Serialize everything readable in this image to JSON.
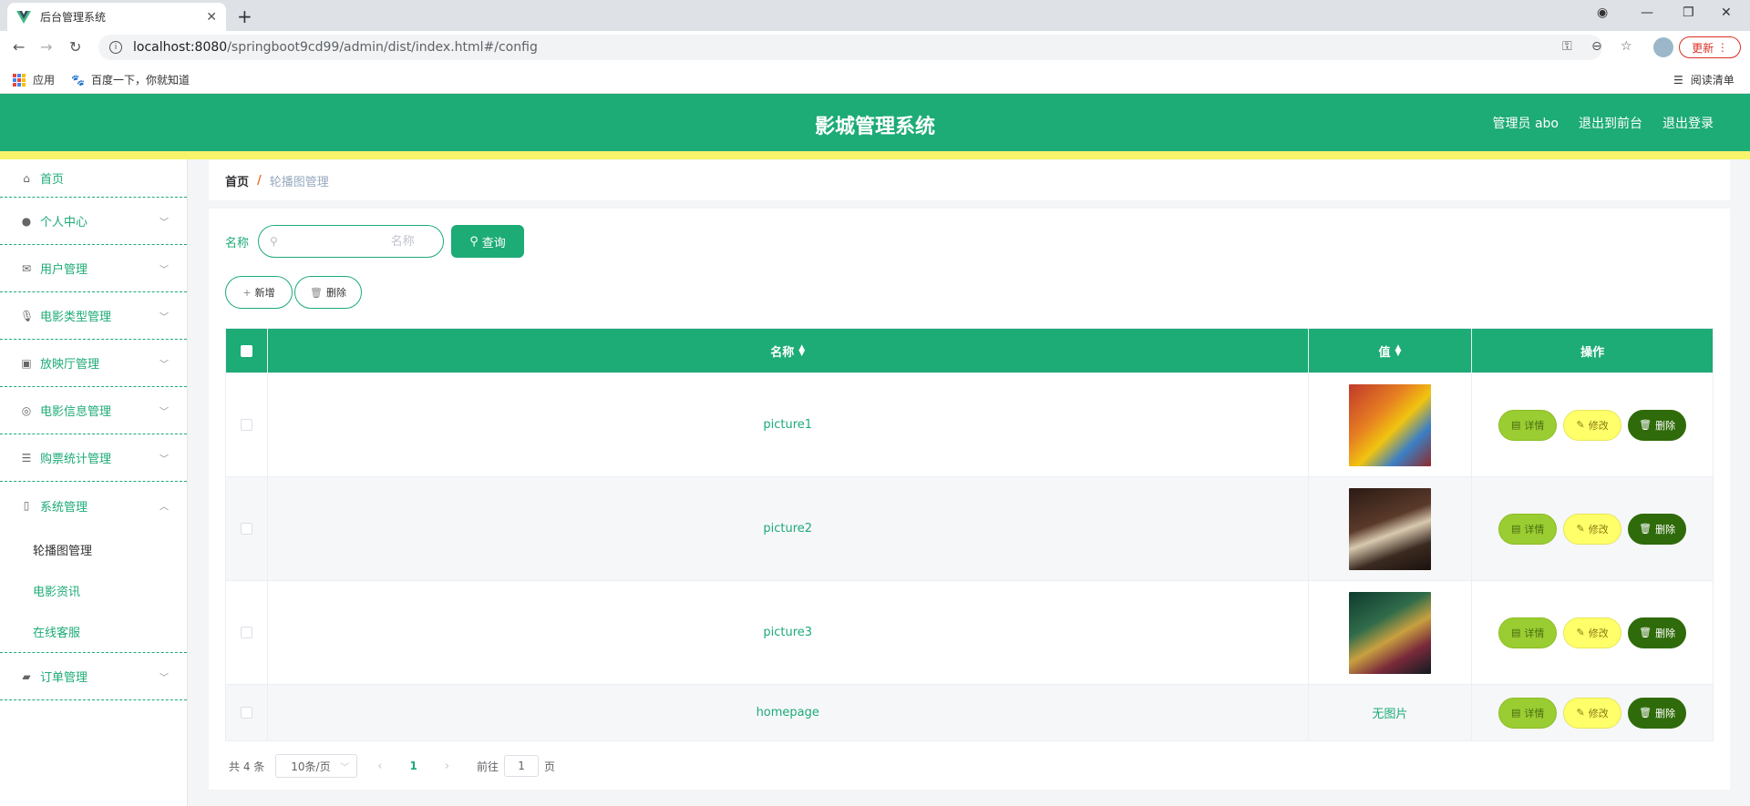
{
  "browser": {
    "tab_title": "后台管理系统",
    "url_host": "localhost:8080",
    "url_path": "/springboot9cd99/admin/dist/index.html#/config",
    "update_label": "更新",
    "bookmarks": [
      {
        "label": "应用"
      },
      {
        "label": "百度一下，你就知道"
      }
    ],
    "reading_list": "阅读清单"
  },
  "header": {
    "title": "影城管理系统",
    "user": "管理员 abo",
    "back_front": "退出到前台",
    "logout": "退出登录"
  },
  "sidebar": {
    "items": [
      {
        "label": "首页",
        "icon": "home-icon"
      },
      {
        "label": "个人中心",
        "icon": "user-icon"
      },
      {
        "label": "用户管理",
        "icon": "mail-icon"
      },
      {
        "label": "电影类型管理",
        "icon": "mic-icon"
      },
      {
        "label": "放映厅管理",
        "icon": "clipboard-icon"
      },
      {
        "label": "电影信息管理",
        "icon": "compass-icon"
      },
      {
        "label": "购票统计管理",
        "icon": "sliders-icon"
      },
      {
        "label": "系统管理",
        "icon": "phone-icon"
      },
      {
        "label": "订单管理",
        "icon": "wallet-icon"
      }
    ],
    "system_sub": [
      {
        "label": "轮播图管理"
      },
      {
        "label": "电影资讯"
      },
      {
        "label": "在线客服"
      }
    ]
  },
  "breadcrumb": {
    "home": "首页",
    "separator": "/",
    "current": "轮播图管理"
  },
  "search": {
    "label": "名称",
    "placeholder": "名称",
    "button": "查询"
  },
  "actions": {
    "add": "新增",
    "delete": "删除"
  },
  "table": {
    "headers": {
      "name": "名称",
      "value": "值",
      "ops": "操作"
    },
    "rows": [
      {
        "name": "picture1",
        "value": "",
        "image": true
      },
      {
        "name": "picture2",
        "value": "",
        "image": true
      },
      {
        "name": "picture3",
        "value": "",
        "image": true
      },
      {
        "name": "homepage",
        "value": "无图片",
        "image": false
      }
    ],
    "op_labels": {
      "detail": "详情",
      "edit": "修改",
      "delete": "删除"
    }
  },
  "pager": {
    "total": "共 4 条",
    "page_size": "10条/页",
    "current": "1",
    "goto_prefix": "前往",
    "goto_value": "1",
    "goto_suffix": "页"
  },
  "colors": {
    "primary": "#1dab76",
    "strip": "#f7f36b",
    "detail": "#9acd32",
    "edit": "#ffff6a",
    "delete": "#2f6b0a"
  }
}
